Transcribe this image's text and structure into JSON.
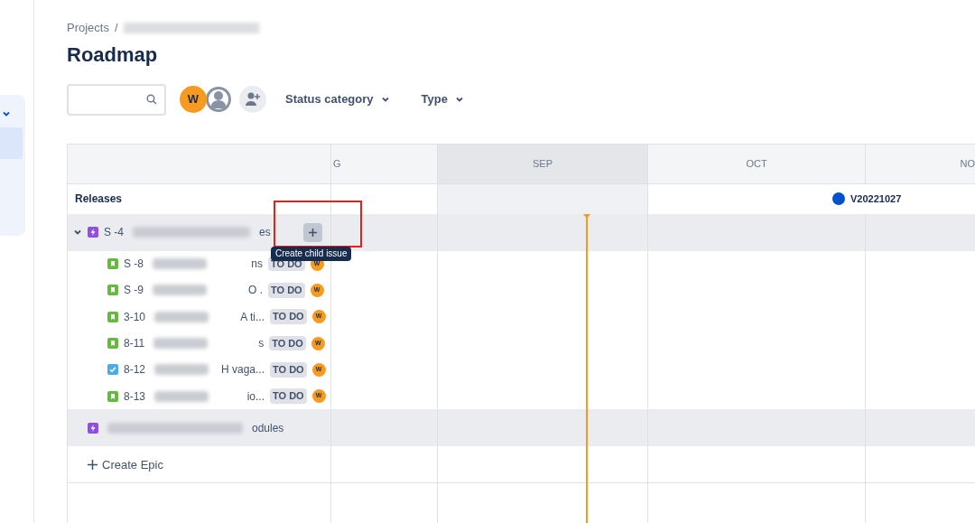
{
  "breadcrumb": {
    "root": "Projects",
    "separator": "/"
  },
  "title": "Roadmap",
  "avatars": [
    {
      "kind": "initial",
      "label": "W"
    },
    {
      "kind": "silhouette"
    }
  ],
  "filters": [
    {
      "label": "Status category"
    },
    {
      "label": "Type"
    }
  ],
  "months": [
    {
      "label": "G",
      "current": false
    },
    {
      "label": "SEP",
      "current": true
    },
    {
      "label": "OCT",
      "current": false
    },
    {
      "label": "NO",
      "current": false
    }
  ],
  "releases": {
    "label": "Releases",
    "markers": [
      {
        "label": "V20221027",
        "color": "#0052cc"
      }
    ]
  },
  "epics": [
    {
      "key": "S -4",
      "summary": "es",
      "expanded": true,
      "tooltip": "Create child issue",
      "children": [
        {
          "kind": "story",
          "key": "S -8",
          "summary": "ns",
          "status": "TO DO",
          "assignee": "W"
        },
        {
          "kind": "story",
          "key": "S -9",
          "summary": "O .",
          "status": "TO DO",
          "assignee": "W"
        },
        {
          "kind": "story",
          "key": "3-10",
          "summary": "A ti...",
          "status": "TO DO",
          "assignee": "W"
        },
        {
          "kind": "story",
          "key": "8-11",
          "summary": "s",
          "status": "TO DO",
          "assignee": "W"
        },
        {
          "kind": "task",
          "key": "8-12",
          "summary": "H vaga...",
          "status": "TO DO",
          "assignee": "W"
        },
        {
          "kind": "story",
          "key": "8-13",
          "summary": "io...",
          "status": "TO DO",
          "assignee": "W"
        }
      ]
    },
    {
      "summary": "odules"
    }
  ],
  "create_epic": "Create Epic"
}
